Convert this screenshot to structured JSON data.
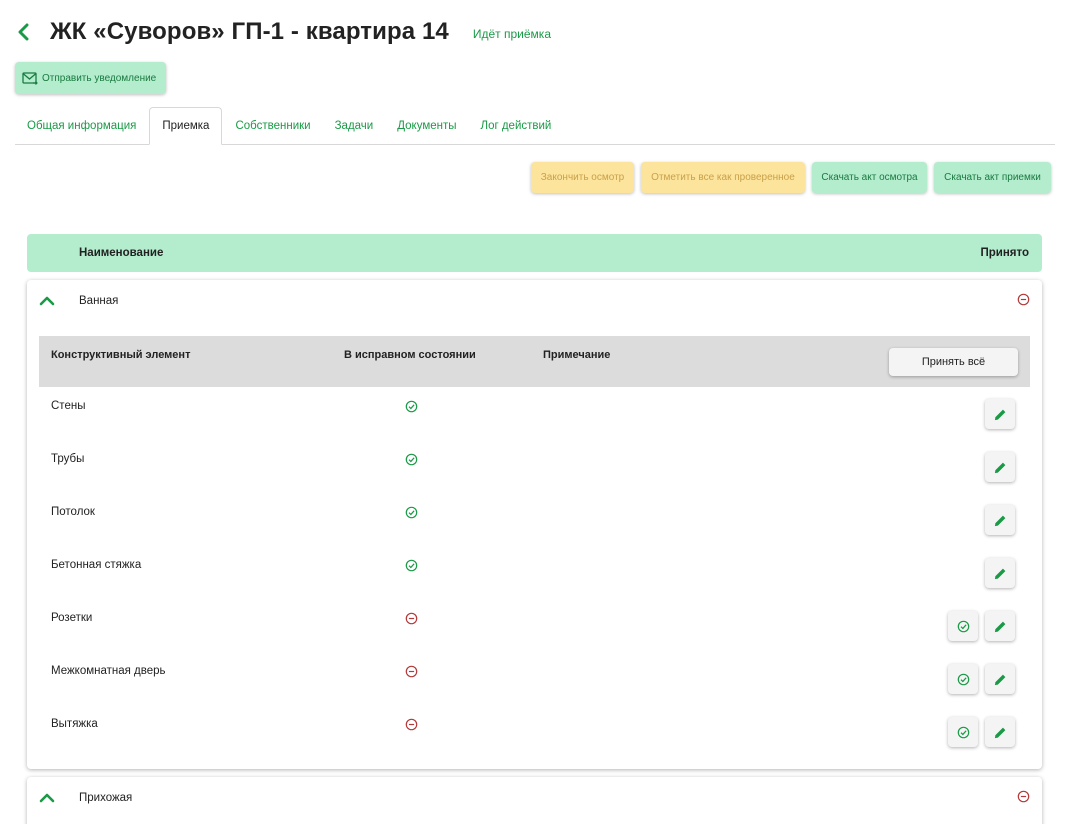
{
  "header": {
    "title": "ЖК «Суворов» ГП-1 - квартира 14",
    "status": "Идёт приёмка"
  },
  "notify_button": {
    "label": "Отправить уведомление"
  },
  "tabs": [
    {
      "label": "Общая информация",
      "active": false
    },
    {
      "label": "Приемка",
      "active": true
    },
    {
      "label": "Собственники",
      "active": false
    },
    {
      "label": "Задачи",
      "active": false
    },
    {
      "label": "Документы",
      "active": false
    },
    {
      "label": "Лог действий",
      "active": false
    }
  ],
  "actions": {
    "finish_inspection": "Закончить осмотр",
    "mark_all_checked": "Отметить все как проверенное",
    "download_inspection_act": "Скачать акт осмотра",
    "download_acceptance_act": "Скачать акт приемки"
  },
  "list_header": {
    "name": "Наименование",
    "accepted": "Принято"
  },
  "rooms": [
    {
      "name": "Ванная",
      "expanded": true,
      "accepted": false,
      "columns": {
        "element": "Конструктивный элемент",
        "ok": "В исправном состоянии",
        "note": "Примечание"
      },
      "accept_all": "Принять всё",
      "items": [
        {
          "name": "Стены",
          "ok": true
        },
        {
          "name": "Трубы",
          "ok": true
        },
        {
          "name": "Потолок",
          "ok": true
        },
        {
          "name": "Бетонная стяжка",
          "ok": true
        },
        {
          "name": "Розетки",
          "ok": false
        },
        {
          "name": "Межкомнатная дверь",
          "ok": false
        },
        {
          "name": "Вытяжка",
          "ok": false
        }
      ]
    },
    {
      "name": "Прихожая",
      "expanded": true,
      "accepted": false
    }
  ],
  "colors": {
    "accent": "#1a9a47",
    "light_green": "#b4ecce",
    "yellow": "#fce49c",
    "error": "#b33a3a"
  },
  "icons": {
    "back": "chevron-left-icon",
    "notify": "mail-icon",
    "collapse": "chevron-up-icon",
    "ok": "check-circle-icon",
    "not_ok": "minus-circle-icon",
    "edit": "pencil-icon"
  }
}
